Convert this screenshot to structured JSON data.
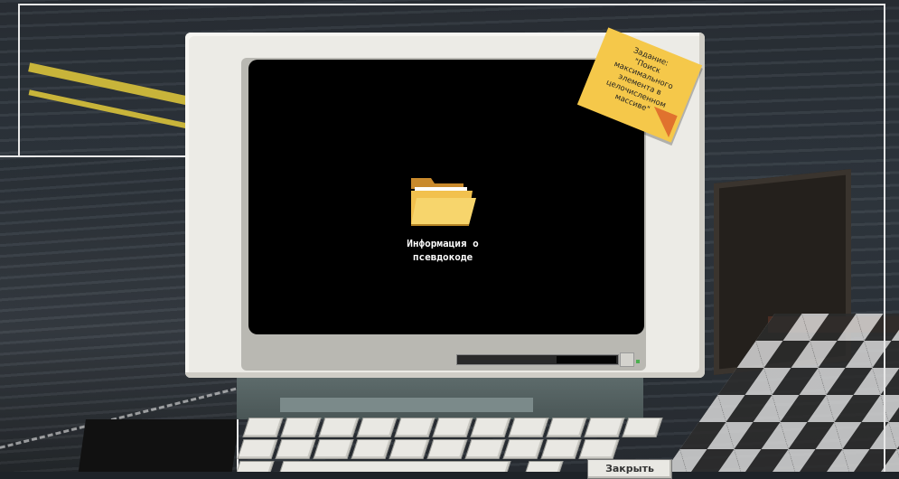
{
  "note": {
    "text": "Задание:\n\"Поиск\nмаксимального\nэлемента в\nцелочисленном\nмассиве\""
  },
  "desktop": {
    "folder_icon": "folder-icon",
    "folder_label": "Информация о\nпсевдокоде"
  },
  "keyboard": {
    "close_label": "Закрыть"
  },
  "colors": {
    "screen": "#000000",
    "monitor": "#ecebe6",
    "note": "#f5c84a",
    "note_fold": "#e0722e",
    "folder": "#f2c14e"
  }
}
